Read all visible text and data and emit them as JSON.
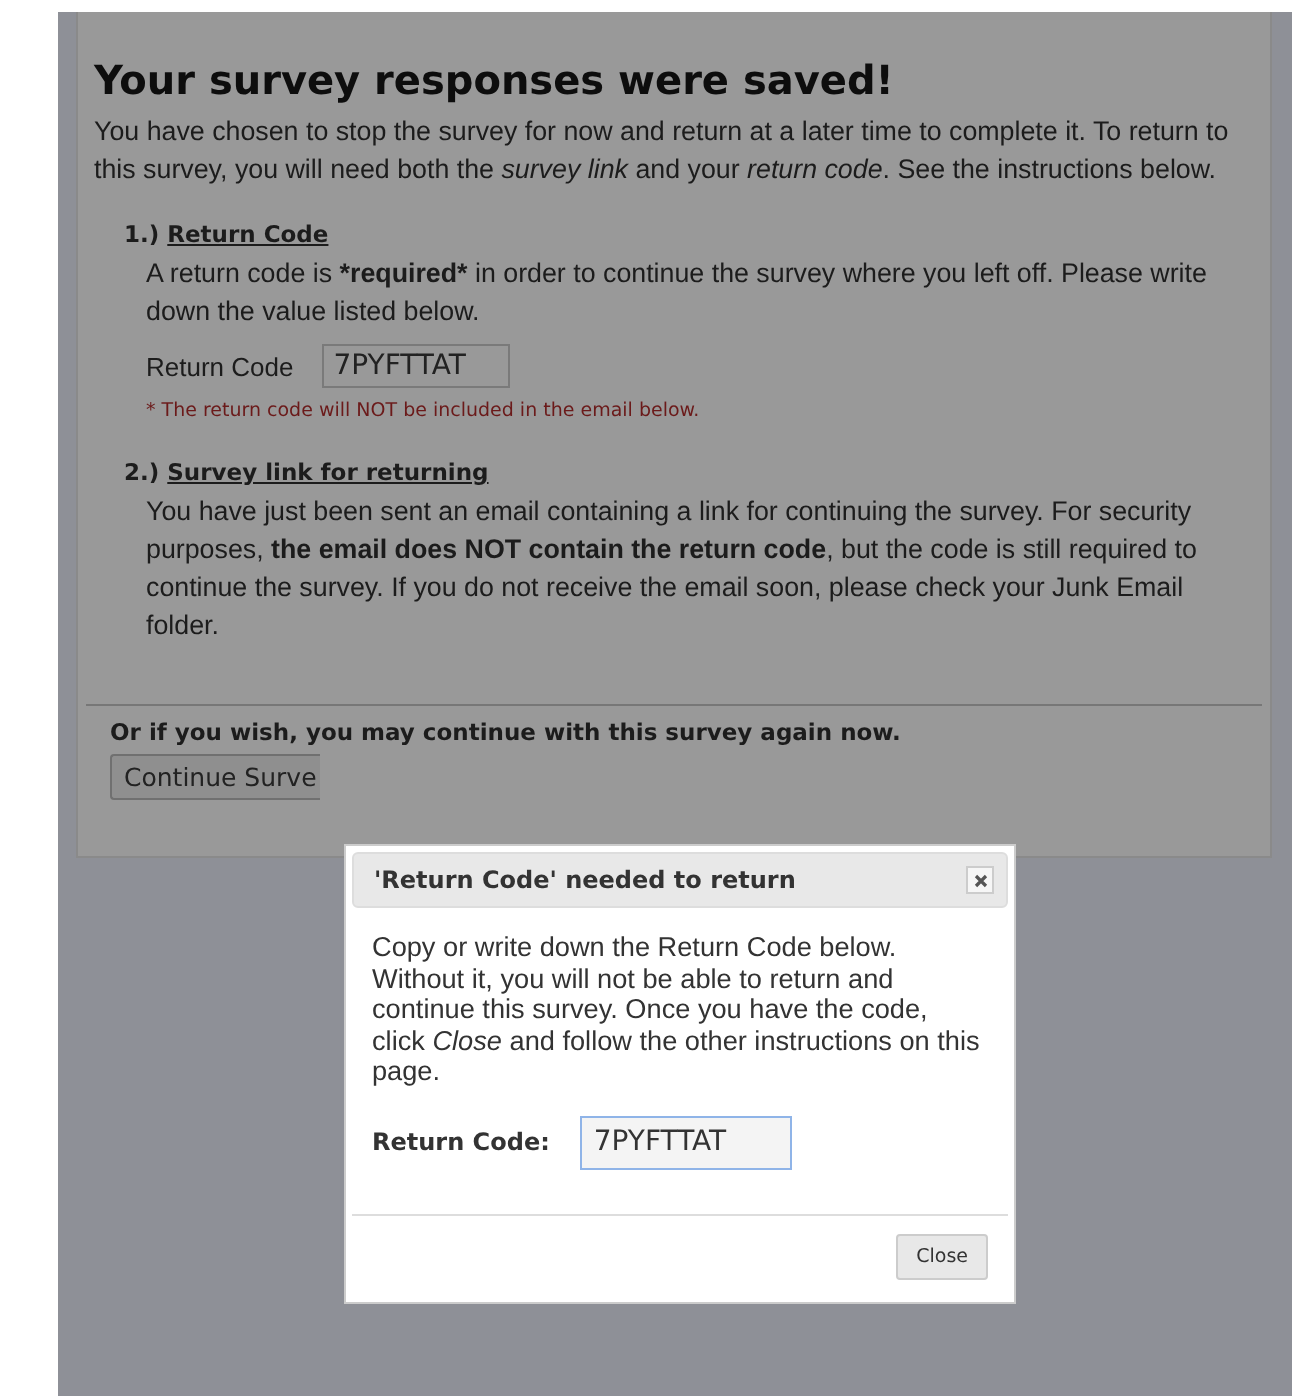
{
  "page": {
    "heading": "Your survey responses were saved!",
    "intro": "You have chosen to stop the survey for now and return at a later time to complete it. To return to this survey, you will need both the *survey link* and your *return code*. See the instructions below.",
    "sections": [
      {
        "number": "1.)",
        "title": "Return Code",
        "runs": [
          {
            "text": "A return code is ",
            "bold": false
          },
          {
            "text": "*required*",
            "bold": true
          },
          {
            "text": " in order to continue the survey where you left off. Please write down the value listed below.",
            "bold": false
          }
        ],
        "field": {
          "label": "Return Code",
          "value": "7PYFTTAT"
        },
        "note": "* The return code will NOT be included in the email below."
      },
      {
        "number": "2.)",
        "title": "Survey link for returning",
        "runs": [
          {
            "text": "You have just been sent an email containing a link for continuing the survey. For security purposes, ",
            "bold": false
          },
          {
            "text": "the email does NOT contain the return code",
            "bold": true
          },
          {
            "text": ", but the code is still required to continue the survey. If you do not receive the email soon, please check your Junk Email folder.",
            "bold": false
          }
        ]
      }
    ],
    "continue": {
      "prompt": "Or if you wish, you may continue with this survey again now.",
      "button": "Continue Surve"
    }
  },
  "dialog": {
    "title": "'Return Code' needed to return",
    "text": "Copy or write down the Return Code below. Without it, you will not be able to return and continue this survey. Once you have the code, click *Close* and follow the other instructions on this page.",
    "field": {
      "label": "Return Code:",
      "value": "7PYFTTAT"
    },
    "buttons": [
      "Close"
    ]
  }
}
